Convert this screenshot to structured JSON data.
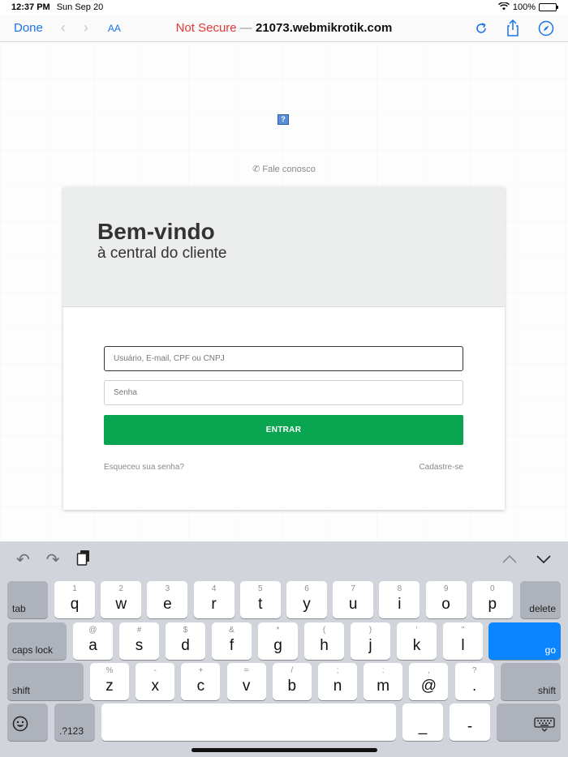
{
  "status_bar": {
    "time": "12:37 PM",
    "date": "Sun Sep 20",
    "battery": "100%"
  },
  "browser": {
    "done_label": "Done",
    "aa_label": "AA",
    "url_insecure": "Not Secure",
    "url_dash": " — ",
    "url_host": "21073.webmikrotik.com"
  },
  "page": {
    "broken_image_glyph": "?",
    "contact_label": "Fale conosco",
    "card": {
      "title": "Bem-vindo",
      "subtitle": "à central do cliente",
      "username_placeholder": "Usuário, E-mail, CPF ou CNPJ",
      "password_placeholder": "Senha",
      "login_button": "ENTRAR",
      "forgot_link": "Esqueceu sua senha?",
      "signup_link": "Cadastre-se"
    }
  },
  "keyboard": {
    "row1": [
      {
        "hint": "1",
        "key": "q"
      },
      {
        "hint": "2",
        "key": "w"
      },
      {
        "hint": "3",
        "key": "e"
      },
      {
        "hint": "4",
        "key": "r"
      },
      {
        "hint": "5",
        "key": "t"
      },
      {
        "hint": "6",
        "key": "y"
      },
      {
        "hint": "7",
        "key": "u"
      },
      {
        "hint": "8",
        "key": "i"
      },
      {
        "hint": "9",
        "key": "o"
      },
      {
        "hint": "0",
        "key": "p"
      }
    ],
    "row2": [
      {
        "hint": "@",
        "key": "a"
      },
      {
        "hint": "#",
        "key": "s"
      },
      {
        "hint": "$",
        "key": "d"
      },
      {
        "hint": "&",
        "key": "f"
      },
      {
        "hint": "*",
        "key": "g"
      },
      {
        "hint": "(",
        "key": "h"
      },
      {
        "hint": ")",
        "key": "j"
      },
      {
        "hint": "'",
        "key": "k"
      },
      {
        "hint": "\"",
        "key": "l"
      }
    ],
    "row3": [
      {
        "hint": "%",
        "key": "z"
      },
      {
        "hint": "-",
        "key": "x"
      },
      {
        "hint": "+",
        "key": "c"
      },
      {
        "hint": "=",
        "key": "v"
      },
      {
        "hint": "/",
        "key": "b"
      },
      {
        "hint": ";",
        "key": "n"
      },
      {
        "hint": ":",
        "key": "m"
      },
      {
        "hint": ",",
        "key": "@"
      },
      {
        "hint": "?",
        "key": "."
      }
    ],
    "tab_label": "tab",
    "delete_label": "delete",
    "caps_label": "caps lock",
    "go_label": "go",
    "shift_label": "shift",
    "numbers_label": ".?123",
    "underscore_label": "_",
    "dash_label": "-",
    "emoji_icon": "emoji-icon",
    "hide_keyboard_icon": "hide-keyboard-icon"
  }
}
